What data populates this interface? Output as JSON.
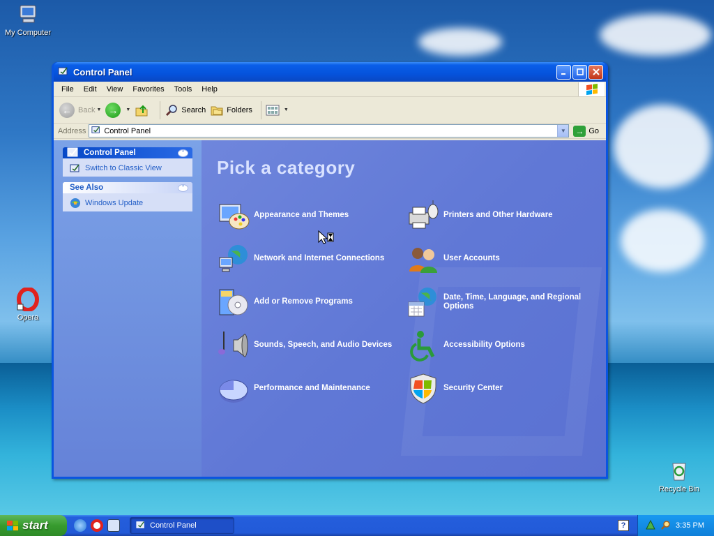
{
  "desktop": {
    "icons": [
      {
        "label": "My Computer"
      },
      {
        "label": "Opera"
      },
      {
        "label": "Recycle Bin"
      }
    ]
  },
  "window": {
    "title": "Control Panel",
    "menu": [
      "File",
      "Edit",
      "View",
      "Favorites",
      "Tools",
      "Help"
    ],
    "toolbar": {
      "back": "Back",
      "search": "Search",
      "folders": "Folders"
    },
    "address": {
      "label": "Address",
      "value": "Control Panel",
      "go": "Go"
    }
  },
  "taskpane": {
    "control_panel": {
      "title": "Control Panel",
      "link": "Switch to Classic View"
    },
    "see_also": {
      "title": "See Also",
      "link": "Windows Update"
    }
  },
  "main": {
    "heading": "Pick a category",
    "categories": [
      {
        "label": "Appearance and Themes"
      },
      {
        "label": "Printers and Other Hardware"
      },
      {
        "label": "Network and Internet Connections"
      },
      {
        "label": "User Accounts"
      },
      {
        "label": "Add or Remove Programs"
      },
      {
        "label": "Date, Time, Language, and Regional Options"
      },
      {
        "label": "Sounds, Speech, and Audio Devices"
      },
      {
        "label": "Accessibility Options"
      },
      {
        "label": "Performance and Maintenance"
      },
      {
        "label": "Security Center"
      }
    ]
  },
  "taskbar": {
    "start": "start",
    "task": "Control Panel",
    "help": "?",
    "clock": "3:35 PM"
  }
}
